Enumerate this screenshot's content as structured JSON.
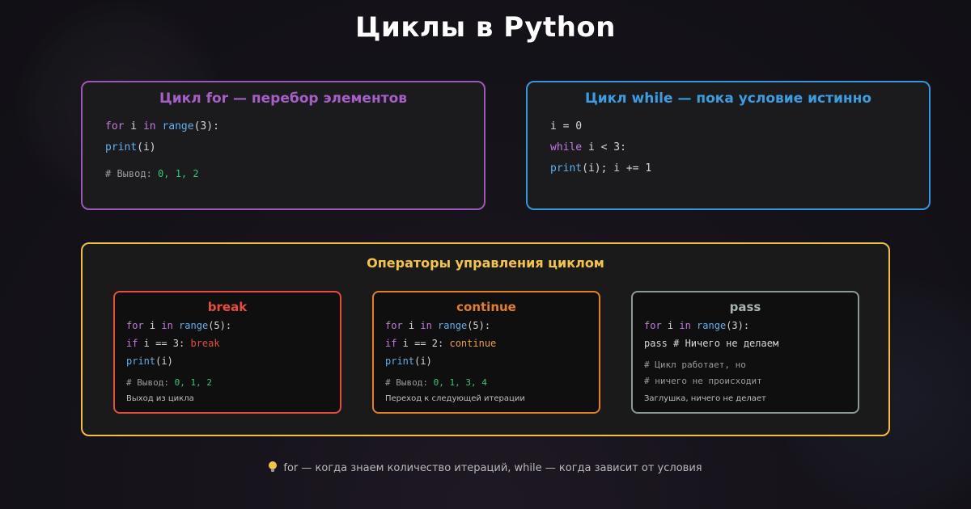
{
  "title": "Циклы в Python",
  "for_card": {
    "title": "Цикл for — перебор элементов",
    "line1": {
      "kw": "for",
      "mid": " i ",
      "kw2": "in",
      "fn": " range",
      "rest": "(3):"
    },
    "line2": {
      "fn": "print",
      "rest": "(i)"
    },
    "comment": {
      "prefix": "# Вывод: ",
      "values": "0, 1, 2"
    }
  },
  "while_card": {
    "title": "Цикл while — пока условие истинно",
    "line1": "i = 0",
    "line2": {
      "kw": "while",
      "rest": " i < 3:"
    },
    "line3": {
      "fn": "print",
      "rest": "(i); i += 1"
    }
  },
  "operators": {
    "title": "Операторы управления циклом",
    "break": {
      "title": "break",
      "line1": {
        "kw": "for",
        "mid": " i ",
        "kw2": "in",
        "fn": " range",
        "rest": "(5):"
      },
      "line2": {
        "kw": "if",
        "mid": " i == 3: ",
        "stmt": "break"
      },
      "line3": {
        "fn": "print",
        "rest": "(i)"
      },
      "comment": {
        "prefix": "# Вывод: ",
        "values": "0, 1, 2"
      },
      "desc": "Выход из цикла"
    },
    "continue": {
      "title": "continue",
      "line1": {
        "kw": "for",
        "mid": " i ",
        "kw2": "in",
        "fn": " range",
        "rest": "(5):"
      },
      "line2": {
        "kw": "if",
        "mid": " i == 2: ",
        "stmt": "continue"
      },
      "line3": {
        "fn": "print",
        "rest": "(i)"
      },
      "comment": {
        "prefix": "# Вывод: ",
        "values": "0, 1, 3, 4"
      },
      "desc": "Переход к следующей итерации"
    },
    "pass": {
      "title": "pass",
      "line1": {
        "kw": "for",
        "mid": " i ",
        "kw2": "in",
        "fn": " range",
        "rest": "(3):"
      },
      "line2": "pass # Ничего не делаем",
      "comment1": "# Цикл работает, но",
      "comment2": "# ничего не происходит",
      "desc": "Заглушка, ничего не делает"
    }
  },
  "footer": "for — когда знаем количество итераций, while — когда зависит от условия",
  "icons": {
    "tip": "lightbulb-icon"
  }
}
